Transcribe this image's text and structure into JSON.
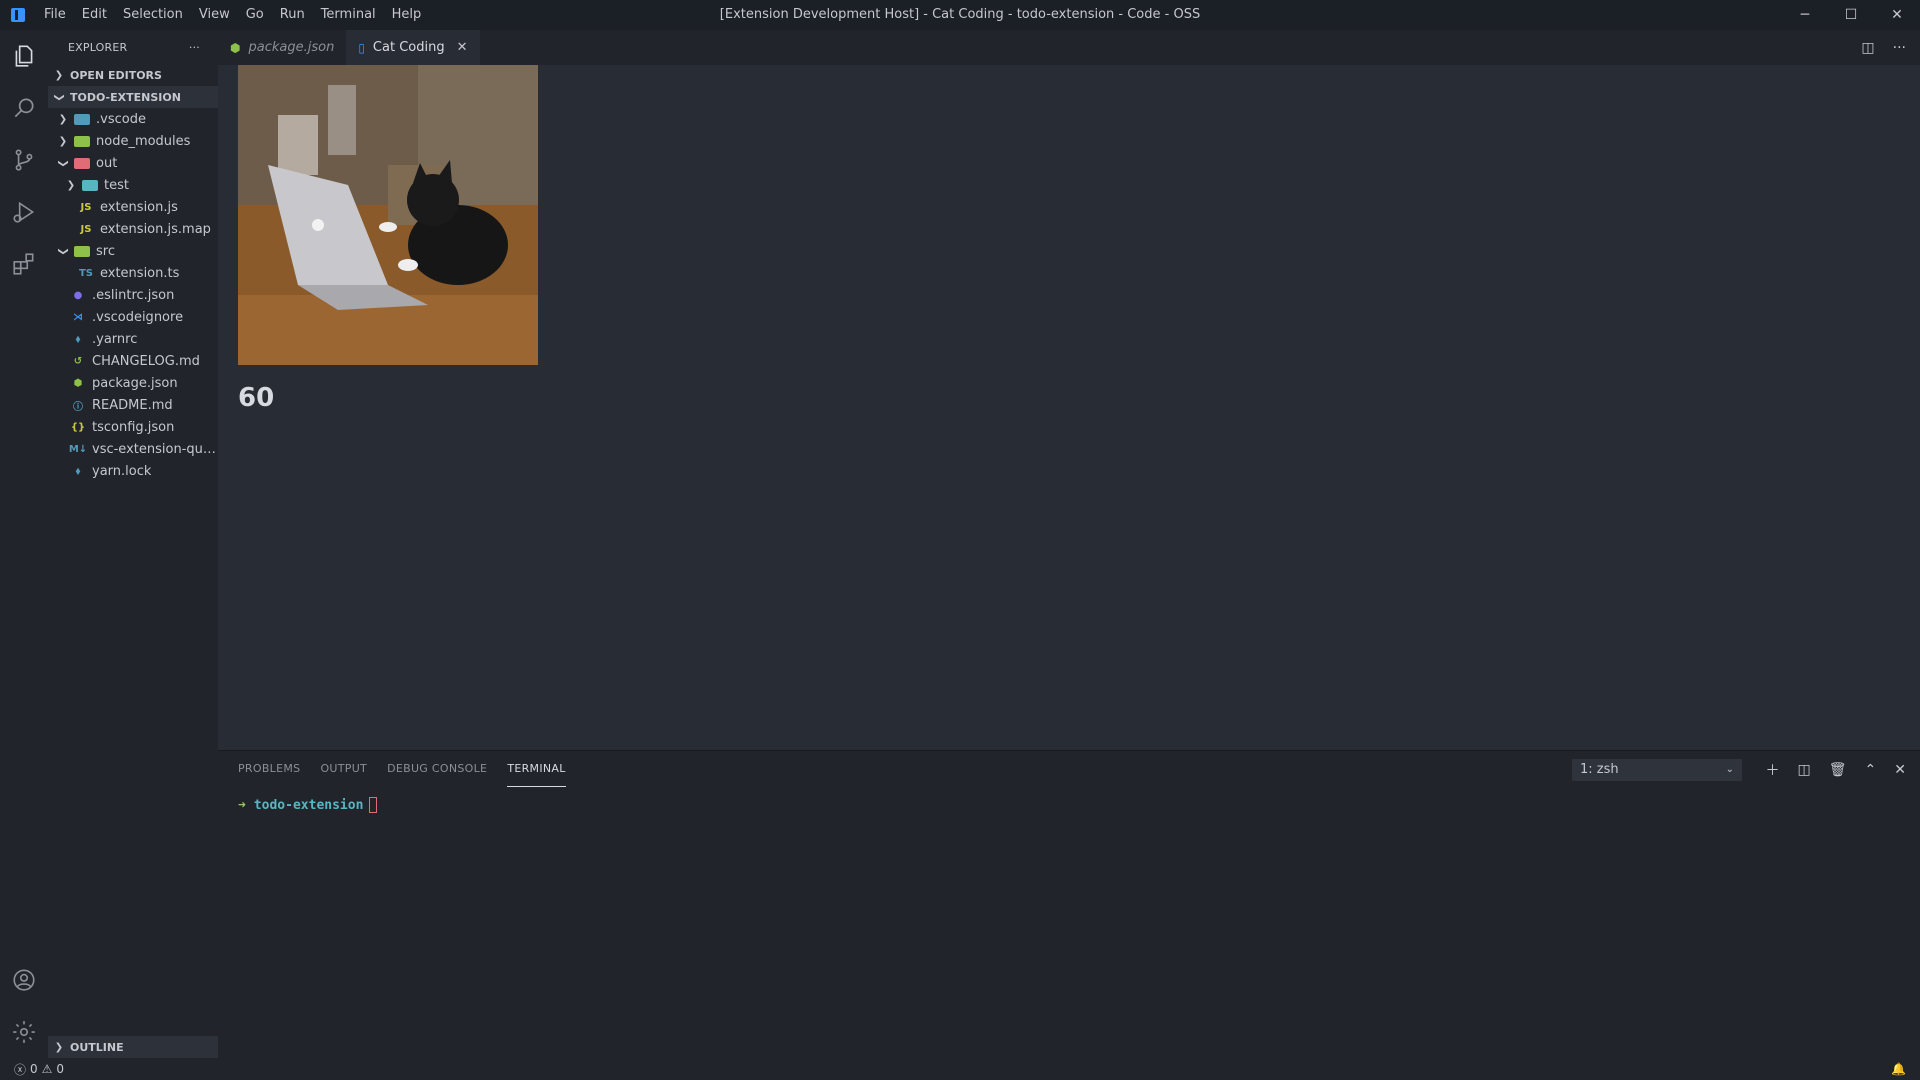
{
  "window": {
    "title": "[Extension Development Host] - Cat Coding - todo-extension - Code - OSS",
    "minimize": "─",
    "maximize": "☐",
    "close": "✕"
  },
  "menu": [
    "File",
    "Edit",
    "Selection",
    "View",
    "Go",
    "Run",
    "Terminal",
    "Help"
  ],
  "sidebar": {
    "title": "EXPLORER",
    "more": "···",
    "open_editors": "OPEN EDITORS",
    "project": "TODO-EXTENSION",
    "outline": "OUTLINE",
    "tree": [
      {
        "label": ".vscode",
        "depth": 1,
        "type": "folder",
        "expanded": false,
        "color": "#519aba"
      },
      {
        "label": "node_modules",
        "depth": 1,
        "type": "folder",
        "expanded": false,
        "color": "#8dc149"
      },
      {
        "label": "out",
        "depth": 1,
        "type": "folder",
        "expanded": true,
        "color": "#e06c75"
      },
      {
        "label": "test",
        "depth": 2,
        "type": "folder",
        "expanded": false,
        "color": "#56b6c2"
      },
      {
        "label": "extension.js",
        "depth": 2,
        "type": "file",
        "icon": "js",
        "color": "#cbcb41"
      },
      {
        "label": "extension.js.map",
        "depth": 2,
        "type": "file",
        "icon": "js",
        "color": "#cbcb41"
      },
      {
        "label": "src",
        "depth": 1,
        "type": "folder",
        "expanded": true,
        "color": "#8dc149"
      },
      {
        "label": "extension.ts",
        "depth": 2,
        "type": "file",
        "icon": "ts",
        "color": "#519aba"
      },
      {
        "label": ".eslintrc.json",
        "depth": 1,
        "type": "file",
        "icon": "eslint",
        "color": "#7b6ee8"
      },
      {
        "label": ".vscodeignore",
        "depth": 1,
        "type": "file",
        "icon": "vscode",
        "color": "#3794ff"
      },
      {
        "label": ".yarnrc",
        "depth": 1,
        "type": "file",
        "icon": "yarn",
        "color": "#519aba"
      },
      {
        "label": "CHANGELOG.md",
        "depth": 1,
        "type": "file",
        "icon": "changelog",
        "color": "#8dc149"
      },
      {
        "label": "package.json",
        "depth": 1,
        "type": "file",
        "icon": "npm",
        "color": "#8dc149"
      },
      {
        "label": "README.md",
        "depth": 1,
        "type": "file",
        "icon": "info",
        "color": "#519aba"
      },
      {
        "label": "tsconfig.json",
        "depth": 1,
        "type": "file",
        "icon": "json",
        "color": "#cbcb41"
      },
      {
        "label": "vsc-extension-quickstart.md",
        "depth": 1,
        "type": "file",
        "icon": "markdown",
        "color": "#519aba"
      },
      {
        "label": "yarn.lock",
        "depth": 1,
        "type": "file",
        "icon": "yarn",
        "color": "#519aba"
      }
    ]
  },
  "tabs": [
    {
      "label": "package.json",
      "active": false,
      "italic": true,
      "icon": "npm"
    },
    {
      "label": "Cat Coding",
      "active": true,
      "italic": false,
      "icon": "file"
    }
  ],
  "editor": {
    "counter": "60",
    "image_alt": "cat typing on a laptop"
  },
  "panel": {
    "tabs": [
      "PROBLEMS",
      "OUTPUT",
      "DEBUG CONSOLE",
      "TERMINAL"
    ],
    "active_tab": "TERMINAL",
    "terminal_select": "1: zsh",
    "prompt_dir": "todo-extension"
  },
  "status": {
    "errors": "0",
    "warnings": "0"
  },
  "colors": {
    "accent": "#3794ff",
    "background": "#282c34",
    "sidebar": "#21252b"
  }
}
